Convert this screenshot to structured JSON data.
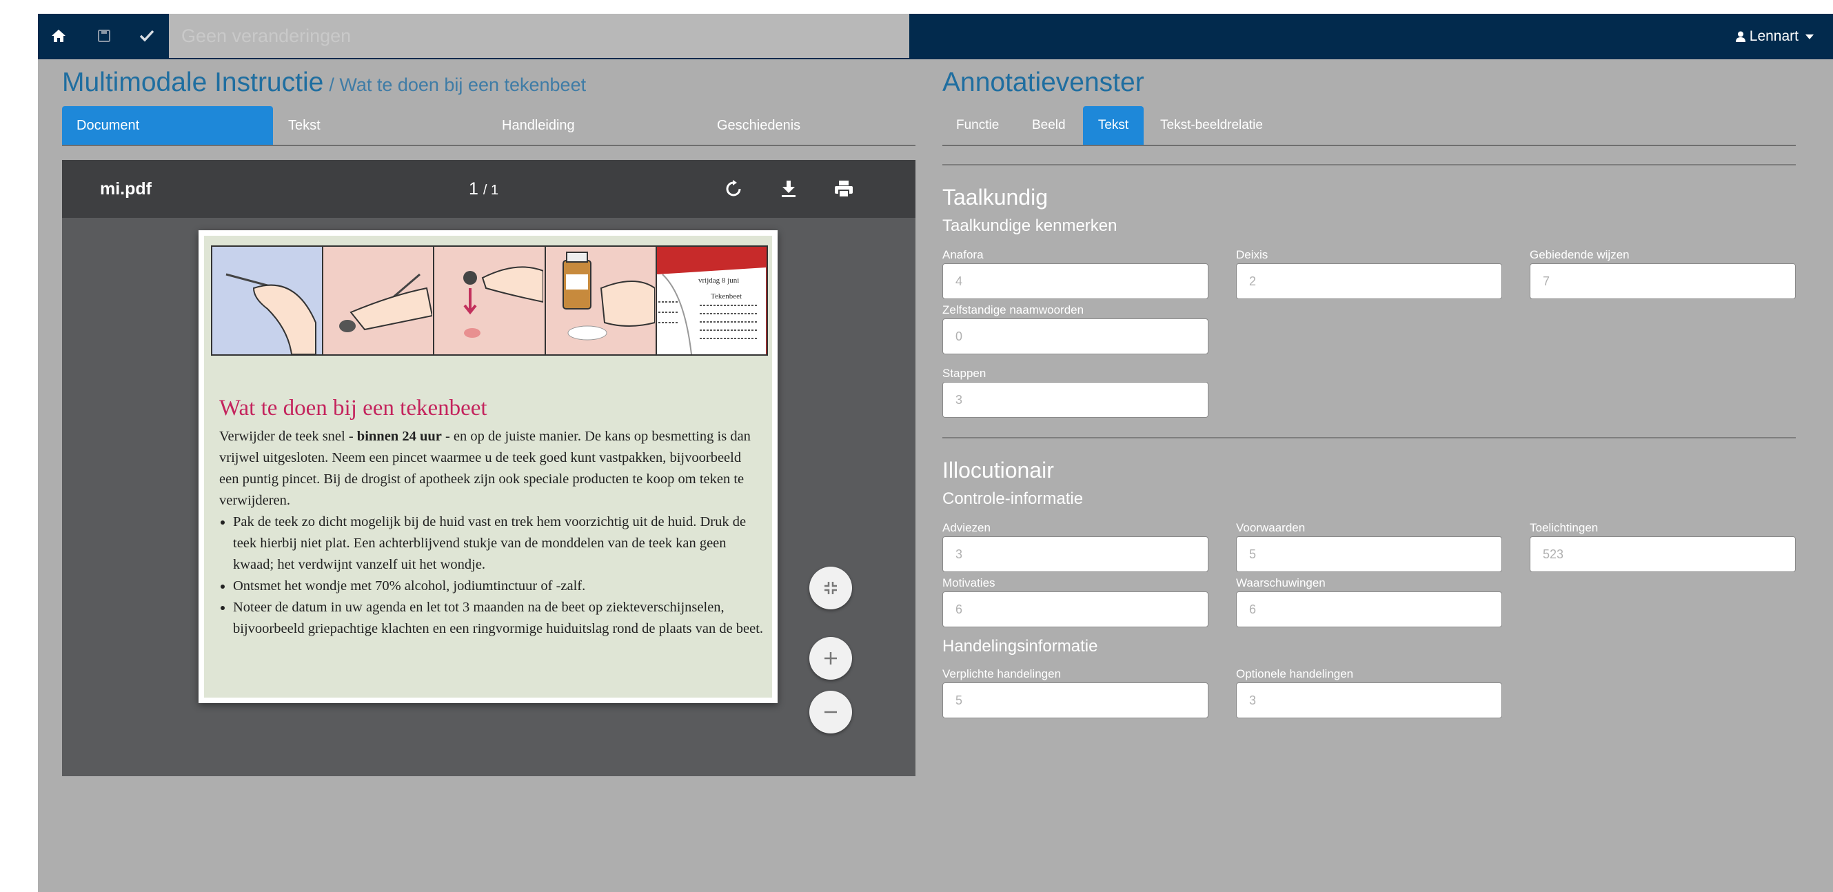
{
  "navbar": {
    "message": "Geen veranderingen",
    "user": "Lennart"
  },
  "left": {
    "title": "Multimodale Instructie",
    "subtitle": "/ Wat te doen bij een tekenbeet",
    "tabs": [
      "Document",
      "Tekst",
      "Handleiding",
      "Geschiedenis"
    ]
  },
  "viewer": {
    "filename": "mi.pdf",
    "page_current": "1",
    "page_total": "1",
    "doc": {
      "title": "Wat te doen bij een tekenbeet",
      "intro_a": "Verwijder de teek snel - ",
      "intro_bold": "binnen 24 uur",
      "intro_b": " - en op de juiste manier. De kans op besmetting is dan vrijwel uitgesloten. Neem een pincet waarmee u de teek goed kunt vastpakken, bijvoorbeeld een puntig pincet. Bij de drogist of apotheek zijn ook speciale producten te koop om teken te verwijderen.",
      "bullets": [
        "Pak de teek zo dicht mogelijk bij de huid vast en trek hem voorzichtig uit de huid. Druk de teek hierbij niet plat. Een achterblijvend stukje van de monddelen van de teek kan geen kwaad; het verdwijnt vanzelf uit het wondje.",
        "Ontsmet het wondje met 70% alcohol, jodiumtinctuur of -zalf.",
        "Noteer de datum in uw agenda en let tot 3 maanden na de beet op ziekteverschijnselen, bijvoorbeeld griepachtige klachten en een ringvormige huiduitslag rond de plaats van de beet."
      ],
      "book_text": "vrijdag 8 juni",
      "book_text2": "Tekenbeet"
    }
  },
  "right": {
    "title": "Annotatievenster",
    "tabs": [
      "Functie",
      "Beeld",
      "Tekst",
      "Tekst-beeldrelatie"
    ],
    "taalkundig": {
      "heading": "Taalkundig",
      "subheading": "Taalkundige kenmerken",
      "fields": [
        {
          "label": "Anafora",
          "value": "4"
        },
        {
          "label": "Deixis",
          "value": "2"
        },
        {
          "label": "Gebiedende wijzen",
          "value": "7"
        },
        {
          "label": "Zelfstandige naamwoorden",
          "value": "0"
        },
        {
          "label": "Stappen",
          "value": "3"
        }
      ]
    },
    "illocutionair": {
      "heading": "Illocutionair",
      "controle": "Controle-informatie",
      "controle_fields": [
        {
          "label": "Adviezen",
          "value": "3"
        },
        {
          "label": "Voorwaarden",
          "value": "5"
        },
        {
          "label": "Toelichtingen",
          "value": "523"
        },
        {
          "label": "Motivaties",
          "value": "6"
        },
        {
          "label": "Waarschuwingen",
          "value": "6"
        }
      ],
      "handeling": "Handelingsinformatie",
      "handeling_fields": [
        {
          "label": "Verplichte handelingen",
          "value": "5"
        },
        {
          "label": "Optionele handelingen",
          "value": "3"
        }
      ]
    }
  },
  "icons": [
    "home-icon",
    "save-icon",
    "check-icon",
    "user-icon",
    "rotate-icon",
    "download-icon",
    "print-icon",
    "fit-page-icon",
    "zoom-in-icon",
    "zoom-out-icon"
  ]
}
